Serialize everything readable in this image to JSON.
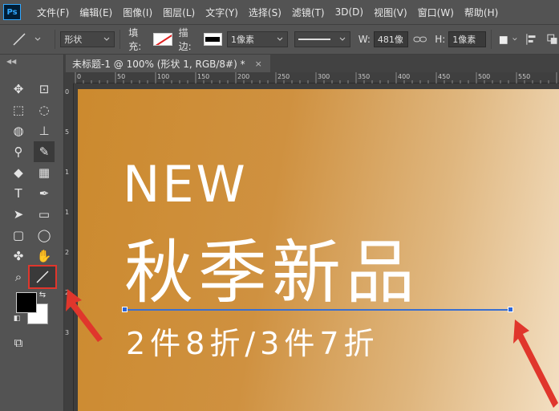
{
  "app": {
    "logo": "Ps"
  },
  "menu": [
    "文件(F)",
    "编辑(E)",
    "图像(I)",
    "图层(L)",
    "文字(Y)",
    "选择(S)",
    "滤镜(T)",
    "3D(D)",
    "视图(V)",
    "窗口(W)",
    "帮助(H)"
  ],
  "options": {
    "mode": "形状",
    "fill_label": "填充:",
    "stroke_label": "描边:",
    "stroke_width": "1像素",
    "w_label": "W:",
    "w_value": "481像",
    "h_label": "H:",
    "h_value": "1像素"
  },
  "document": {
    "tab_title": "未标题-1 @ 100% (形状 1, RGB/8#) *",
    "close": "×"
  },
  "ruler": {
    "h_labels": [
      "0",
      "50",
      "100",
      "150",
      "200",
      "250",
      "300",
      "350",
      "400",
      "450",
      "500",
      "550"
    ],
    "v_labels": [
      "0",
      "5",
      "1",
      "1",
      "2",
      "2",
      "3"
    ]
  },
  "canvas": {
    "line1": "NEW",
    "line2": "秋季新品",
    "line3": "2件8折/3件7折"
  },
  "colors": {
    "accent_red": "#e0362c",
    "anchor_blue": "#2c66d8",
    "fg": "#000000",
    "bg": "#ffffff"
  }
}
